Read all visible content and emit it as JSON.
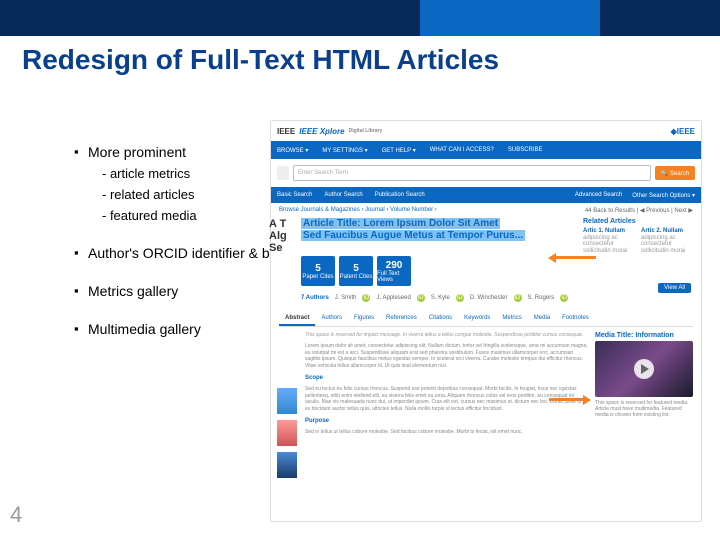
{
  "title": "Redesign of Full-Text HTML Articles",
  "page_number": "4",
  "bullets": {
    "b1": "More prominent",
    "b1a": "- article metrics",
    "b1b": "- related articles",
    "b1c": "- featured media",
    "b2": "Author's ORCID identifier & bio",
    "b3": "Metrics gallery",
    "b4": "Multimedia gallery"
  },
  "ss": {
    "logo": "IEEE Xplore",
    "logo_sub": "Digital Library",
    "brand": "◆IEEE",
    "nav": {
      "browse": "BROWSE ▾",
      "settings": "MY SETTINGS ▾",
      "help": "GET HELP ▾",
      "access": "WHAT CAN I ACCESS?",
      "sub": "SUBSCRIBE"
    },
    "search_ph": "Enter Search Term",
    "search_btn": "🔍 Search",
    "subnav": {
      "basic": "Basic Search",
      "author": "Author Search",
      "pub": "Publication Search",
      "adv": "Advanced Search",
      "other": "Other Search Options ▾"
    },
    "breadcrumb": "Browse Journals & Magazines  ›  Journal  ›  Volume Number  ›",
    "bcnav": "44  Back to Results   |   ◀ Previous   |   Next ▶",
    "art_title_l1": "Article Title: Lorem Ipsum Dolor Sit Amet",
    "art_title_l2": "Sed Faucibus Augue Metus at Tempor Purus...",
    "truncated_title": "A T\nAlg\nSe",
    "related_h": "Related Articles",
    "rel": [
      {
        "t": "Artic 1. Nullam",
        "d": "adipiscing ac consectetur sollicitudin morai"
      },
      {
        "t": "Artic 2. Nullam",
        "d": "adipiscing ac consectetur sollicitudin morai"
      }
    ],
    "viewall": "View All",
    "metrics": [
      {
        "n": "5",
        "l": "Paper Cites"
      },
      {
        "n": "5",
        "l": "Patent Cites"
      },
      {
        "n": "290",
        "l": "Full Text Views"
      }
    ],
    "authors_n": "7 Authors",
    "authors": [
      "J. Smith",
      "J. Appleseed",
      "S. Kyle",
      "D. Winchester",
      "S. Rogers"
    ],
    "tabs": [
      "Abstract",
      "Authors",
      "Figures",
      "References",
      "Citations",
      "Keywords",
      "Metrics",
      "Media",
      "Footnotes"
    ],
    "body": {
      "notice": "This space is reserved for impact message. In viverra tellus a tellus congue molestie. Suspendisse porttitor cursus consequat.",
      "p1": "Lorem ipsum dolor sit amet, consectetur adipiscing elit. Nullam dictum, tortor vel fringilla scelerisque, urna mi accumsan magna, eu volutpat mi est a arci. Suspendisse aliquam erat sed pharetra vestibulum. Fusce maximus ullamcorper orci, accumsan sagittis ipsum. Quisque faucibus metus egestas semper. In scelerat orci viverra. Curabe molestie tempus dui efficitur rhoncus. Vitae vehicula tellus ullamcorper id. Ut quis imal elementum nisi.",
      "h1": "Scope",
      "p2": "Sed eu lectus eu felis cursus rhoncus. Suspend sse potenti depotbus consequat. Morbi facilis. In feugiat, risus nec egestas pellentesq, nibh enim eleifend elit, eu viverra felis emet eu urna. Aliquam rhoncus cobis vel eros porttitor, eu consequat mi iaculis. Mae vis malesuada nunc dui, ut imperdiet ipsum. Cras elit est, cursus nec maximus et, dictum nec leo. Donec pelle or, eu tincidunt auctor tellus quis, ultricies tellus. Nulla mollis turpis ut lectus efficitur tincidunt.",
      "h2": "Purpose",
      "p3": "Sed in tellus ut tellus cobore molesbe. Sed facibus cobore molesbe. Morbi ts feciat, isit emet nunc."
    },
    "media": {
      "h": "Media Title: Information",
      "cap": "This space is reserved for featured media. Article must have multimedia. Featured media is chosen from existing list."
    }
  }
}
